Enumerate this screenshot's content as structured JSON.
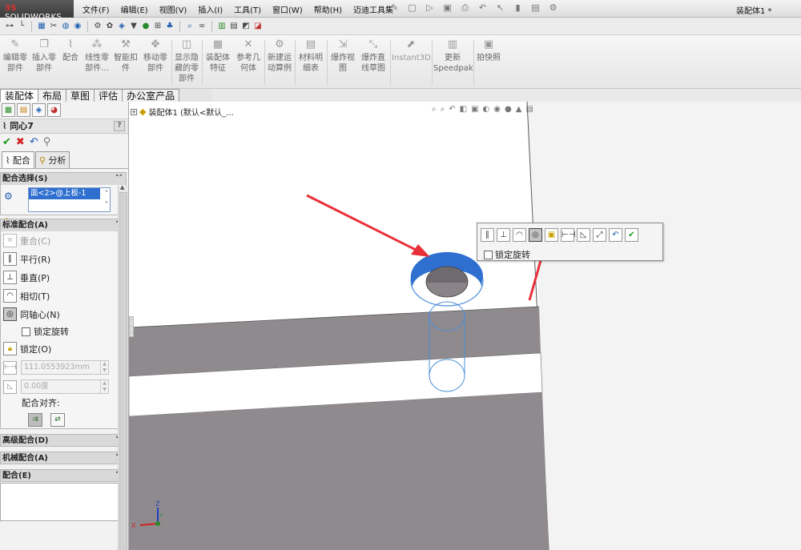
{
  "app": {
    "logo_prefix": "3S",
    "logo_name": "SOLIDWORKS",
    "document_title": "装配体1 *"
  },
  "menu": [
    "文件(F)",
    "编辑(E)",
    "视图(V)",
    "插入(I)",
    "工具(T)",
    "窗口(W)",
    "帮助(H)",
    "迈迪工具集"
  ],
  "commands": [
    {
      "label": "编辑零\n部件"
    },
    {
      "label": "插入零\n部件"
    },
    {
      "label": "配合"
    },
    {
      "label": "线性零\n部件..."
    },
    {
      "label": "智能扣\n件"
    },
    {
      "label": "移动零\n部件"
    },
    {
      "label": "显示隐\n藏的零\n部件"
    },
    {
      "label": "装配体\n特征"
    },
    {
      "label": "参考几\n何体"
    },
    {
      "label": "新建运\n动算例"
    },
    {
      "label": "材料明\n细表"
    },
    {
      "label": "爆炸视\n图"
    },
    {
      "label": "爆炸直\n线草图"
    },
    {
      "label": "Instant3D"
    },
    {
      "label": "更新\nSpeedpak"
    },
    {
      "label": "拍快照"
    }
  ],
  "tabs": [
    "装配体",
    "布局",
    "草图",
    "评估",
    "办公室产品"
  ],
  "property_manager": {
    "title": "同心7",
    "subtabs": [
      "配合",
      "分析"
    ],
    "mate_selection": {
      "header": "配合选择(S)",
      "selected": "面<2>@上板-1"
    },
    "standard_mates": {
      "header": "标准配合(A)",
      "items": [
        {
          "label": "重合(C)",
          "enabled": false
        },
        {
          "label": "平行(R)",
          "enabled": true
        },
        {
          "label": "垂直(P)",
          "enabled": true
        },
        {
          "label": "相切(T)",
          "enabled": true
        },
        {
          "label": "同轴心(N)",
          "enabled": true,
          "selected": true
        }
      ],
      "lock_rotation": "锁定旋转",
      "lock": "锁定(O)",
      "distance": "111.0553923mm",
      "angle": "0.00度",
      "alignment_label": "配合对齐:"
    },
    "advanced_mates": "高级配合(D)",
    "mechanical_mates": "机械配合(A)",
    "mates": "配合(E)"
  },
  "viewport": {
    "tree_label": "装配体1  (默认<默认_...",
    "context_toolbar": {
      "lock_rotation": "锁定旋转"
    },
    "triad": {
      "x": "X",
      "y": "Y",
      "z": "Z"
    }
  },
  "colors": {
    "selection_blue": "#2f6fd0",
    "plate_gray": "#8f8a8e",
    "ok_green": "#1f9a1f",
    "arrow_red": "#e8303a"
  }
}
